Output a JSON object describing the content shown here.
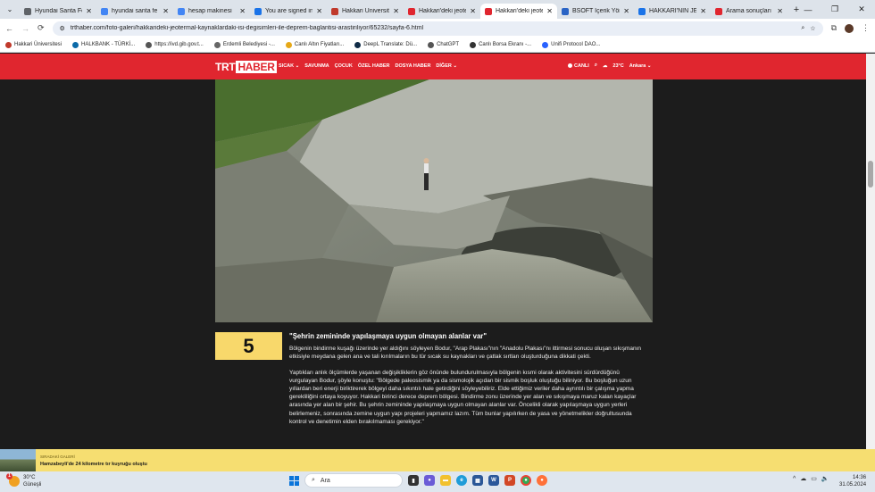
{
  "browser": {
    "tabs": [
      {
        "title": "Hyundai Santa Fe",
        "color": "#5f6368"
      },
      {
        "title": "hyundai santa fe",
        "color": "#4285f4"
      },
      {
        "title": "hesap makinesi",
        "color": "#4285f4"
      },
      {
        "title": "You are signed in",
        "color": "#1a73e8"
      },
      {
        "title": "Hakkari Üniversit",
        "color": "#c0392b"
      },
      {
        "title": "Hakkari'deki jeote",
        "color": "#e0262f"
      },
      {
        "title": "Hakkari'deki jeote",
        "color": "#e0262f",
        "active": true
      },
      {
        "title": "BSOFT İçerik Yöne",
        "color": "#2a64c5"
      },
      {
        "title": "HAKKARİ'NİN JEO",
        "color": "#1a73e8"
      },
      {
        "title": "Arama sonuçları",
        "color": "#e0262f"
      }
    ],
    "url": "trthaber.com/foto-galeri/hakkarideki-jeotermal-kaynaklardaki-isi-degisimleri-ile-deprem-baglantisi-arastiriliyor/65232/sayfa-6.html",
    "bookmarks": [
      {
        "label": "Hakkari Üniversitesi",
        "color": "#c0392b"
      },
      {
        "label": "HALKBANK - TÜRKİ...",
        "color": "#0b6aa8"
      },
      {
        "label": "https://ivd.gib.gov.t...",
        "color": "#555555"
      },
      {
        "label": "Erdemli Belediyesi -...",
        "color": "#666666"
      },
      {
        "label": "Canlı Altın Fiyatları...",
        "color": "#e6a817"
      },
      {
        "label": "DeepL Translate: Dü...",
        "color": "#0f2b46"
      },
      {
        "label": "ChatGPT",
        "color": "#555555"
      },
      {
        "label": "Canlı Borsa Ekranı -...",
        "color": "#333333"
      },
      {
        "label": "Uniﬁ Protocol DAO...",
        "color": "#2962ff"
      }
    ]
  },
  "site": {
    "logo_a": "TRT",
    "logo_b": "HABER",
    "nav": [
      "SICAK ⌄",
      "SAVUNMA",
      "ÇOCUK",
      "ÖZEL HABER",
      "DOSYA HABER",
      "DİĞER ⌄"
    ],
    "live": "CANLI",
    "weather": "23°C",
    "city": "Ankara ⌄"
  },
  "article": {
    "number": "5",
    "heading": "\"Şehrin zemininde yapılaşmaya uygun olmayan alanlar var\"",
    "p1": "Bölgenin bindirme kuşağı üzerinde yer aldığını söyleyen Bodur, \"Arap Plakası\"nın \"Anadolu Plakası\"nı ittirmesi sonucu oluşan sıkışmanın etkisiyle meydana gelen ana ve tali kırılmaların bu tür sıcak su kaynakları ve çatlak sırtları oluşturduğuna dikkati çekti.",
    "p2": "Yaptıkları anlık ölçümlerde yaşanan değişikliklerin göz önünde bulundurulmasıyla bölgenin kısmi olarak aktivitesini sürdürdüğünü vurgulayan Bodur, şöyle konuştu: \"Bölgede paleosismik ya da sismolojik açıdan bir sismik boşluk oluştuğu biliniyor. Bu boşluğun uzun yıllardan beri enerji biriktirerek bölgeyi daha sıkıntılı hale getirdiğini söyleyebiliriz. Elde ettiğimiz veriler daha ayrıntılı bir çalışma yapma gerekliliğini ortaya koyuyor. Hakkari birinci derece deprem bölgesi. Bindirme zonu üzerinde yer alan ve sıkışmaya maruz kalan kayaçlar arasında yer alan bir şehir. Bu şehrin zemininde yapılaşmaya uygun olmayan alanlar var. Öncelikli olarak yapılaşmaya uygun yerleri belirlemeniz, sonrasında zemine uygun yapı projeleri yapmamız lazım. Tüm bunlar yapılırken de yasa ve yönetmelikler doğrultusunda kontrol ve denetimin elden bırakılmaması gerekiyor.\""
  },
  "ticker": {
    "kicker": "SIRADAKİ GALERİ",
    "headline": "Hamzabeyli'de 24 kilometre tır kuyruğu oluştu"
  },
  "taskbar": {
    "temp": "30°C",
    "condition": "Güneşli",
    "badge": "1",
    "search_placeholder": "Ara",
    "time": "14:36",
    "date": "31.05.2024"
  }
}
